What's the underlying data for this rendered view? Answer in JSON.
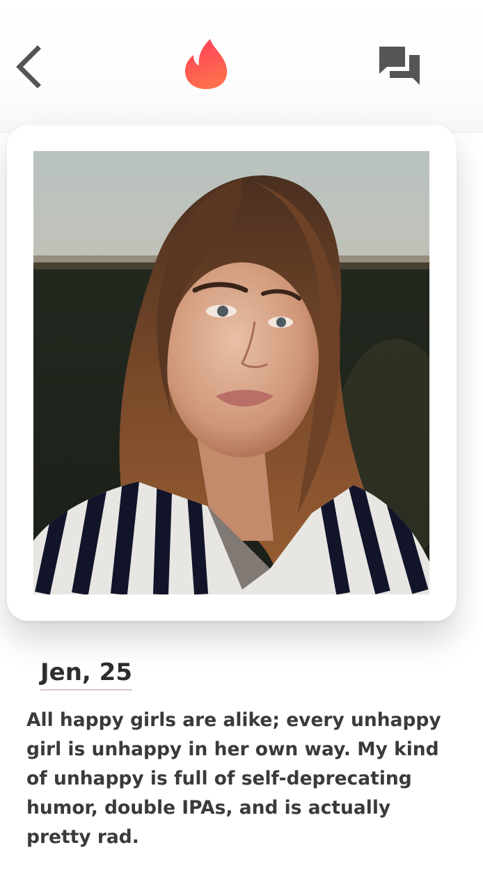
{
  "header": {
    "back_icon": "chevron-left-icon",
    "logo_icon": "flame-icon",
    "chat_icon": "chat-bubbles-icon",
    "colors": {
      "flame_top": "#ff4458",
      "flame_bottom": "#fd6e4f",
      "icon_gray": "#555555"
    }
  },
  "profile": {
    "photo_icon": "profile-photo",
    "name_age": "Jen, 25",
    "bio": "All happy girls are alike; every unhappy girl is unhappy in her own way. My kind of unhappy is full of self-deprecating humor, double IPAs, and is actually pretty rad."
  }
}
